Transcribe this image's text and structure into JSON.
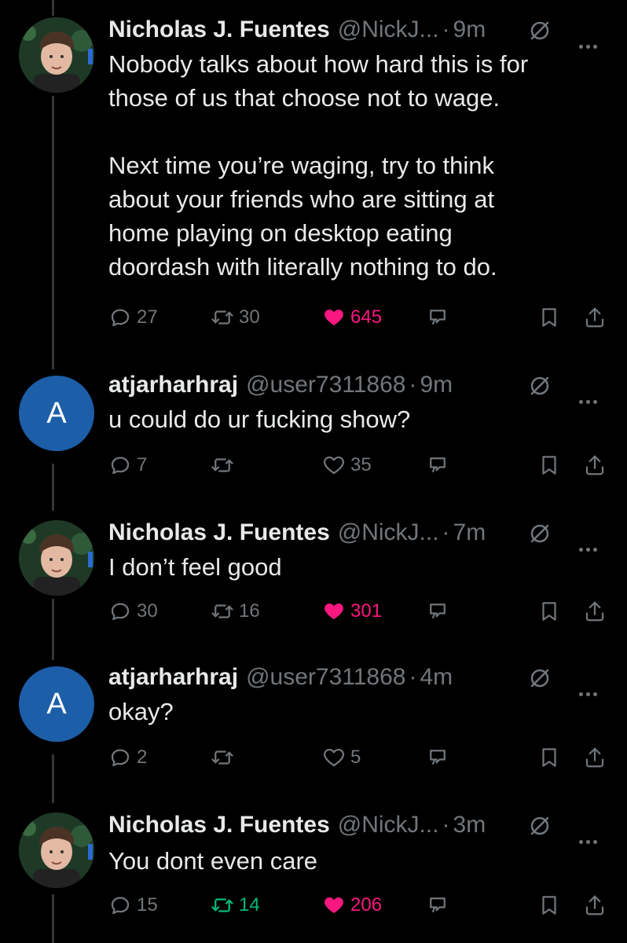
{
  "tweets": [
    {
      "name": "Nicholas J. Fuentes",
      "handle": "@NickJ...",
      "dot": "·",
      "time": "9m",
      "avatar_type": "photo",
      "text": "Nobody talks about how hard this is for\nthose of us that choose not to wage.\n\nNext time you’re waging, try to think\nabout your friends who are sitting at\nhome playing on desktop eating\ndoordash with literally nothing to do.",
      "replies": "27",
      "retweets": "30",
      "likes": "645",
      "liked": true,
      "retweeted": false
    },
    {
      "name": "atjarharhraj",
      "handle": "@user7311868",
      "dot": "·",
      "time": "9m",
      "avatar_type": "letter",
      "avatar_letter": "A",
      "text": "u could do ur fucking show?",
      "replies": "7",
      "retweets": "",
      "likes": "35",
      "liked": false,
      "retweeted": false
    },
    {
      "name": "Nicholas J. Fuentes",
      "handle": "@NickJ...",
      "dot": "·",
      "time": "7m",
      "avatar_type": "photo",
      "text": "I don’t feel good",
      "replies": "30",
      "retweets": "16",
      "likes": "301",
      "liked": true,
      "retweeted": false
    },
    {
      "name": "atjarharhraj",
      "handle": "@user7311868",
      "dot": "·",
      "time": "4m",
      "avatar_type": "letter",
      "avatar_letter": "A",
      "text": "okay?",
      "replies": "2",
      "retweets": "",
      "likes": "5",
      "liked": false,
      "retweeted": false
    },
    {
      "name": "Nicholas J. Fuentes",
      "handle": "@NickJ...",
      "dot": "·",
      "time": "3m",
      "avatar_type": "photo",
      "text": "You dont even care",
      "replies": "15",
      "retweets": "14",
      "likes": "206",
      "liked": true,
      "retweeted": true
    }
  ],
  "colors": {
    "background": "#000000",
    "text": "#e7e9ea",
    "secondary": "#71767b",
    "like": "#f91880",
    "retweet": "#00ba7c",
    "letter_avatar": "#1d5ea8"
  },
  "icons": [
    "reply-icon",
    "retweet-icon",
    "heart-icon",
    "grok-icon",
    "bookmark-icon",
    "share-icon",
    "more-icon"
  ]
}
